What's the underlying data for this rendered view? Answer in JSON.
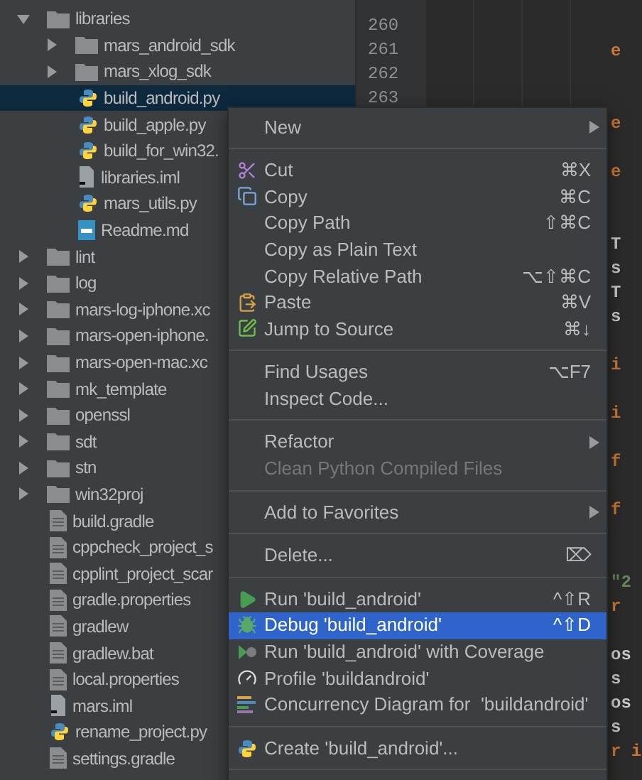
{
  "tree": [
    {
      "label": "libraries",
      "kind": "folder",
      "expanded": true,
      "selected": false,
      "children": [
        {
          "label": "mars_android_sdk",
          "kind": "folder",
          "expanded": false,
          "selected": false
        },
        {
          "label": "mars_xlog_sdk",
          "kind": "folder",
          "expanded": false,
          "selected": false
        },
        {
          "label": "build_android.py",
          "kind": "python",
          "selected": true
        },
        {
          "label": "build_apple.py",
          "kind": "python",
          "selected": false
        },
        {
          "label": "build_for_win32.",
          "kind": "python",
          "selected": false
        },
        {
          "label": "libraries.iml",
          "kind": "module",
          "selected": false
        },
        {
          "label": "mars_utils.py",
          "kind": "python",
          "selected": false
        },
        {
          "label": "Readme.md",
          "kind": "markdown",
          "selected": false
        }
      ]
    },
    {
      "label": "lint",
      "kind": "folder",
      "expanded": false,
      "selected": false
    },
    {
      "label": "log",
      "kind": "folder",
      "expanded": false,
      "selected": false
    },
    {
      "label": "mars-log-iphone.xc",
      "kind": "folder",
      "expanded": false,
      "selected": false
    },
    {
      "label": "mars-open-iphone.",
      "kind": "folder",
      "expanded": false,
      "selected": false
    },
    {
      "label": "mars-open-mac.xc",
      "kind": "folder",
      "expanded": false,
      "selected": false
    },
    {
      "label": "mk_template",
      "kind": "folder",
      "expanded": false,
      "selected": false
    },
    {
      "label": "openssl",
      "kind": "folder",
      "expanded": false,
      "selected": false
    },
    {
      "label": "sdt",
      "kind": "folder",
      "expanded": false,
      "selected": false
    },
    {
      "label": "stn",
      "kind": "folder",
      "expanded": false,
      "selected": false
    },
    {
      "label": "win32proj",
      "kind": "folder",
      "expanded": false,
      "selected": false
    },
    {
      "label": "build.gradle",
      "kind": "text",
      "selected": false
    },
    {
      "label": "cppcheck_project_s",
      "kind": "text",
      "selected": false
    },
    {
      "label": "cpplint_project_scar",
      "kind": "text",
      "selected": false
    },
    {
      "label": "gradle.properties",
      "kind": "text",
      "selected": false
    },
    {
      "label": "gradlew",
      "kind": "text",
      "selected": false
    },
    {
      "label": "gradlew.bat",
      "kind": "text",
      "selected": false
    },
    {
      "label": "local.properties",
      "kind": "text",
      "selected": false
    },
    {
      "label": "mars.iml",
      "kind": "module",
      "selected": false
    },
    {
      "label": "rename_project.py",
      "kind": "python",
      "selected": false
    },
    {
      "label": "settings.gradle",
      "kind": "text",
      "selected": false
    }
  ],
  "line_numbers": [
    "260",
    "261",
    "262",
    "263"
  ],
  "code_fragments": [
    {
      "kind": "blank"
    },
    {
      "kind": "keyword",
      "text": "e"
    },
    {
      "kind": "blank"
    },
    {
      "kind": "blank"
    },
    {
      "kind": "keyword",
      "text": "e"
    },
    {
      "kind": "blank"
    },
    {
      "kind": "keyword",
      "text": "e"
    },
    {
      "kind": "blank"
    },
    {
      "kind": "blank"
    },
    {
      "kind": "plain",
      "text": "T"
    },
    {
      "kind": "plain",
      "text": "s"
    },
    {
      "kind": "plain",
      "text": "T"
    },
    {
      "kind": "plain",
      "text": "s"
    },
    {
      "kind": "blank"
    },
    {
      "kind": "keyword",
      "text": "i"
    },
    {
      "kind": "blank"
    },
    {
      "kind": "keyword",
      "text": "i"
    },
    {
      "kind": "blank"
    },
    {
      "kind": "keyword",
      "text": "f"
    },
    {
      "kind": "blank"
    },
    {
      "kind": "keyword",
      "text": "f"
    },
    {
      "kind": "blank"
    },
    {
      "kind": "blank"
    },
    {
      "kind": "string",
      "text": "\"2"
    },
    {
      "kind": "keyword",
      "text": "r"
    },
    {
      "kind": "blank"
    },
    {
      "kind": "plain",
      "text": "os"
    },
    {
      "kind": "plain",
      "text": "s"
    },
    {
      "kind": "plain",
      "text": "os"
    },
    {
      "kind": "plain",
      "text": "s"
    },
    {
      "kind": "keyword",
      "text": "r i"
    }
  ],
  "context_menu": [
    {
      "kind": "item",
      "label": "New",
      "submenu": true,
      "disabled": false,
      "selected": false
    },
    {
      "kind": "separator"
    },
    {
      "kind": "cut",
      "label": "Cut",
      "shortcut": "⌘X",
      "submenu": false,
      "disabled": false,
      "selected": false
    },
    {
      "kind": "copy",
      "label": "Copy",
      "shortcut": "⌘C",
      "submenu": false,
      "disabled": false,
      "selected": false
    },
    {
      "kind": "item",
      "label": "Copy Path",
      "shortcut": "⇧⌘C",
      "submenu": false,
      "disabled": false,
      "selected": false
    },
    {
      "kind": "item",
      "label": "Copy as Plain Text",
      "submenu": false,
      "disabled": false,
      "selected": false
    },
    {
      "kind": "item",
      "label": "Copy Relative Path",
      "shortcut": "⌥⇧⌘C",
      "submenu": false,
      "disabled": false,
      "selected": false
    },
    {
      "kind": "paste",
      "label": "Paste",
      "shortcut": "⌘V",
      "submenu": false,
      "disabled": false,
      "selected": false
    },
    {
      "kind": "jump",
      "label": "Jump to Source",
      "shortcut": "⌘↓",
      "submenu": false,
      "disabled": false,
      "selected": false
    },
    {
      "kind": "separator"
    },
    {
      "kind": "item",
      "label": "Find Usages",
      "shortcut": "⌥F7",
      "submenu": false,
      "disabled": false,
      "selected": false
    },
    {
      "kind": "item",
      "label": "Inspect Code...",
      "submenu": false,
      "disabled": false,
      "selected": false
    },
    {
      "kind": "separator"
    },
    {
      "kind": "item",
      "label": "Refactor",
      "submenu": true,
      "disabled": false,
      "selected": false
    },
    {
      "kind": "item",
      "label": "Clean Python Compiled Files",
      "submenu": false,
      "disabled": true,
      "selected": false
    },
    {
      "kind": "separator"
    },
    {
      "kind": "item",
      "label": "Add to Favorites",
      "submenu": true,
      "disabled": false,
      "selected": false
    },
    {
      "kind": "separator"
    },
    {
      "kind": "item",
      "label": "Delete...",
      "shortcut": "⌦",
      "submenu": false,
      "disabled": false,
      "selected": false
    },
    {
      "kind": "separator"
    },
    {
      "kind": "run",
      "label": "Run 'build_android'",
      "shortcut": "^⇧R",
      "submenu": false,
      "disabled": false,
      "selected": false
    },
    {
      "kind": "debug",
      "label": "Debug 'build_android'",
      "shortcut": "^⇧D",
      "submenu": false,
      "disabled": false,
      "selected": true
    },
    {
      "kind": "coverage",
      "label": "Run 'build_android' with Coverage",
      "submenu": false,
      "disabled": false,
      "selected": false
    },
    {
      "kind": "profile",
      "label": "Profile 'buildandroid'",
      "submenu": false,
      "disabled": false,
      "selected": false
    },
    {
      "kind": "concurrency",
      "label": "Concurrency Diagram for  'buildandroid'",
      "submenu": false,
      "disabled": false,
      "selected": false
    },
    {
      "kind": "separator"
    },
    {
      "kind": "create",
      "label": "Create 'build_android'...",
      "submenu": false,
      "disabled": false,
      "selected": false
    },
    {
      "kind": "separator"
    }
  ]
}
